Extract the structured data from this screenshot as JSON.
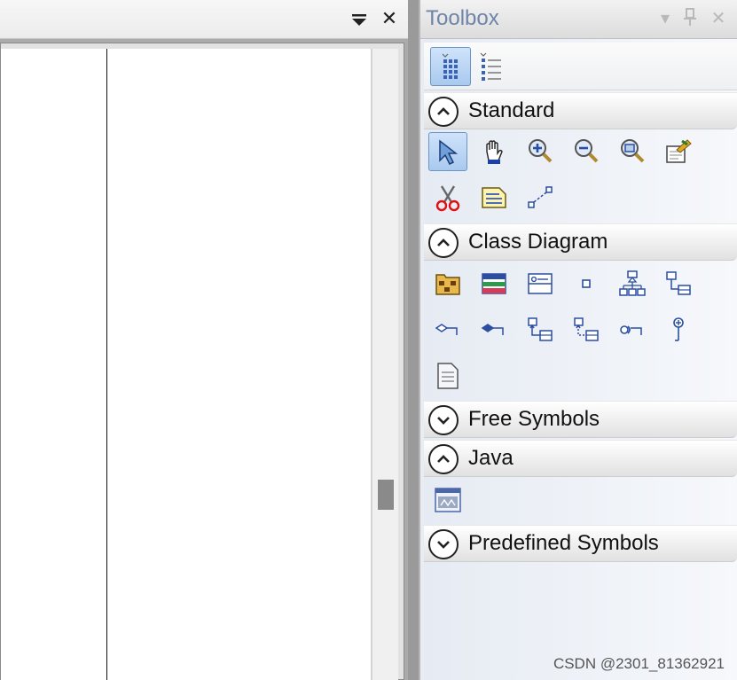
{
  "document": {
    "header_controls": {
      "dropdown_glyph": "▾",
      "close_glyph": "✕"
    }
  },
  "toolbox": {
    "title": "Toolbox",
    "controls": {
      "dropdown_glyph": "▾",
      "pin_glyph": "⊥",
      "close_glyph": "✕"
    },
    "views": [
      {
        "icon": "grid-view-icon",
        "active": true
      },
      {
        "icon": "list-view-icon",
        "active": false
      }
    ],
    "sections": [
      {
        "label": "Standard",
        "expanded": true
      },
      {
        "label": "Class Diagram",
        "expanded": true
      },
      {
        "label": "Free Symbols",
        "expanded": false
      },
      {
        "label": "Java",
        "expanded": true
      },
      {
        "label": "Predefined Symbols",
        "expanded": false
      }
    ]
  },
  "watermark": "CSDN @2301_81362921",
  "colors": {
    "title_text": "#6e84a8",
    "selected_fill": "#a9c9ee",
    "selected_border": "#6b95c8"
  }
}
